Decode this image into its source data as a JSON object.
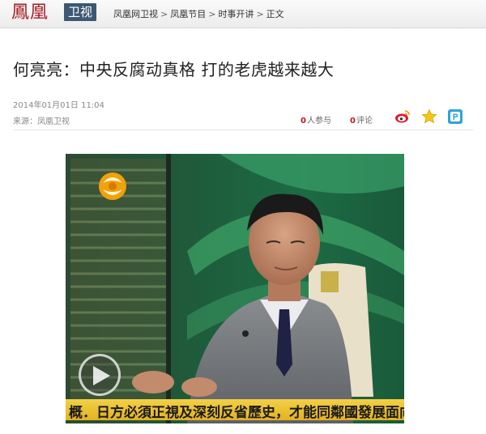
{
  "header": {
    "logo_text": "鳳凰",
    "logo_badge": "卫视",
    "breadcrumb": [
      "凤凰网卫视",
      "凤凰节目",
      "时事开讲",
      "正文"
    ],
    "separator": ">"
  },
  "article": {
    "title": "何亮亮：中央反腐动真格 打的老虎越来越大",
    "datetime": "2014年01月01日 11:04",
    "source": "来源：凤凰卫视",
    "participants": {
      "count": "0",
      "label": "人参与"
    },
    "comments": {
      "count": "0",
      "label": "评论"
    }
  },
  "share_icons": [
    "weibo-icon",
    "favorite-star-icon",
    "qzone-icon"
  ],
  "video": {
    "ticker_text": "概．日方必須正視及深刻反省歷史，才能同鄰國發展面向",
    "channel_logo": "phoenix-logo"
  },
  "colors": {
    "brand_red": "#a41f24",
    "badge_blue": "#3c5872",
    "count_red": "#c0181e",
    "ticker_yellow": "#f2d048"
  }
}
